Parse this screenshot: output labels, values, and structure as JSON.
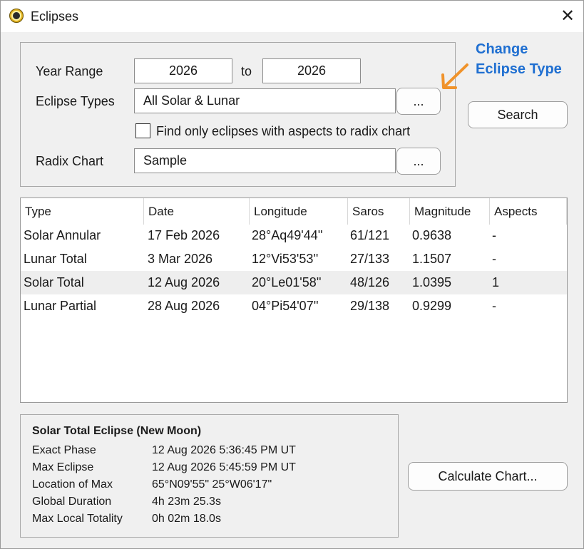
{
  "window": {
    "title": "Eclipses"
  },
  "form": {
    "year_range_label": "Year Range",
    "year_from": "2026",
    "to_label": "to",
    "year_to": "2026",
    "eclipse_types_label": "Eclipse Types",
    "eclipse_types_value": "All Solar & Lunar",
    "browse_label": "...",
    "aspects_checkbox_label": "Find only eclipses with aspects to radix chart",
    "aspects_checked": false,
    "radix_chart_label": "Radix Chart",
    "radix_chart_value": "Sample"
  },
  "annotation": {
    "line1": "Change",
    "line2": "Eclipse Type",
    "color": "#1f6fd1",
    "arrow_color": "#f0932b"
  },
  "search_button": "Search",
  "table": {
    "headers": [
      "Type",
      "Date",
      "Longitude",
      "Saros",
      "Magnitude",
      "Aspects"
    ],
    "rows": [
      [
        "Solar Annular",
        "17 Feb 2026",
        "28°Aq49'44''",
        "61/121",
        "0.9638",
        "-"
      ],
      [
        "Lunar Total",
        "3 Mar 2026",
        "12°Vi53'53''",
        "27/133",
        "1.1507",
        "-"
      ],
      [
        "Solar Total",
        "12 Aug 2026",
        "20°Le01'58''",
        "48/126",
        "1.0395",
        "1"
      ],
      [
        "Lunar Partial",
        "28 Aug 2026",
        "04°Pi54'07''",
        "29/138",
        "0.9299",
        "-"
      ]
    ],
    "selected_row": 2
  },
  "details": {
    "title": "Solar Total Eclipse (New Moon)",
    "rows": [
      {
        "label": "Exact Phase",
        "value": "12 Aug 2026 5:36:45 PM UT"
      },
      {
        "label": "Max Eclipse",
        "value": "12 Aug 2026 5:45:59 PM UT"
      },
      {
        "label": "Location of Max",
        "value": "65°N09'55\" 25°W06'17\""
      },
      {
        "label": "Global Duration",
        "value": "4h 23m 25.3s"
      },
      {
        "label": "Max Local Totality",
        "value": "0h 02m 18.0s"
      }
    ]
  },
  "calculate_button": "Calculate Chart..."
}
